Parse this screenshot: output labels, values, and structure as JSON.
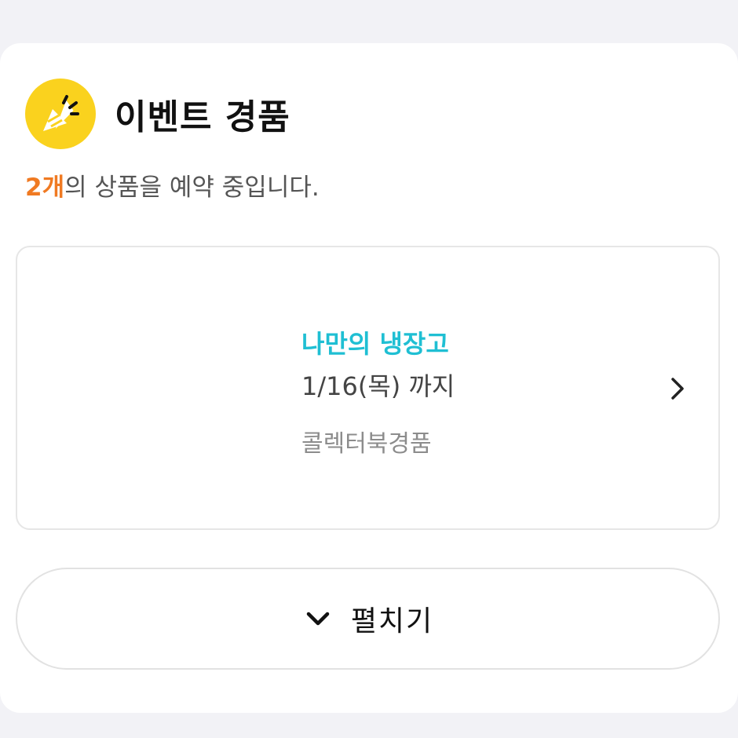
{
  "header": {
    "icon": "party-popper-icon",
    "title": "이벤트 경품"
  },
  "summary": {
    "count": "2개",
    "text": "의 상품을 예약 중입니다."
  },
  "product": {
    "name": "나만의 냉장고",
    "date": "1/16(목) 까지",
    "category": "콜렉터북경품"
  },
  "expand": {
    "label": "펼치기"
  },
  "colors": {
    "accent_count": "#f07a22",
    "product_name": "#1fbfd3",
    "icon_bg": "#fad21e"
  }
}
